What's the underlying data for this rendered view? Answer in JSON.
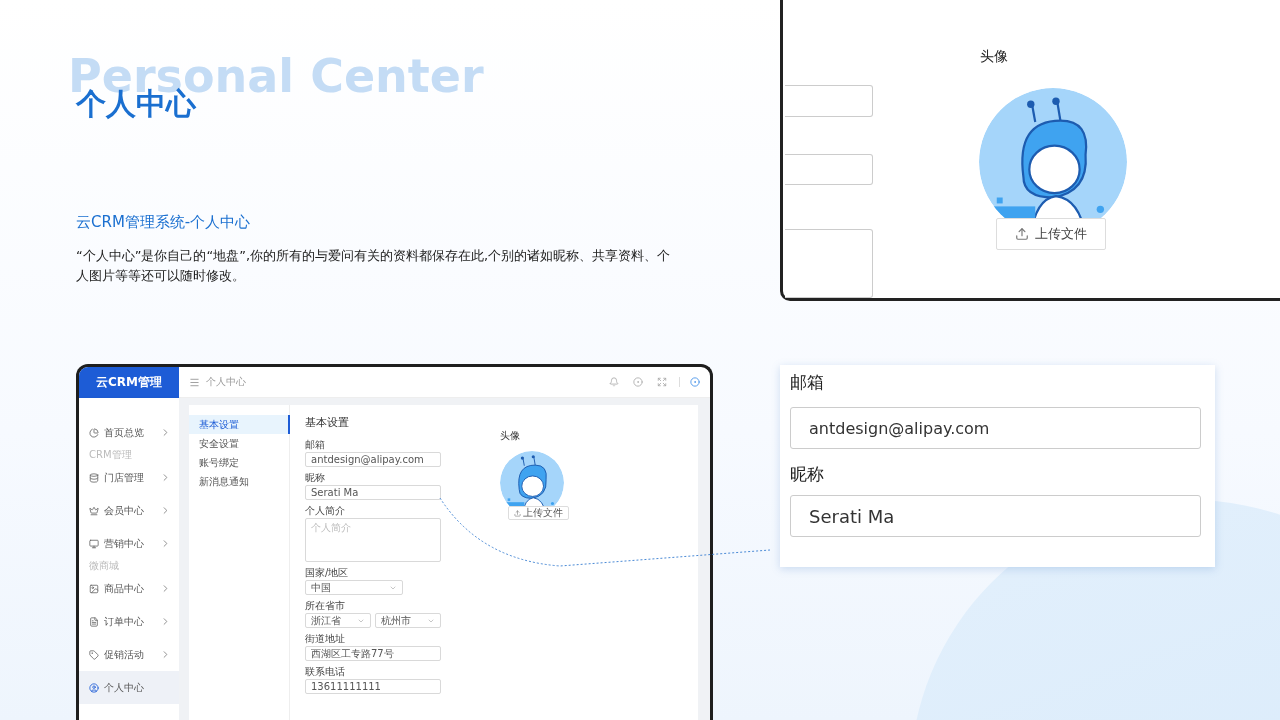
{
  "hero": {
    "ghost_title": "Personal Center",
    "title": "个人中心",
    "subtitle": "云CRM管理系统-个人中心",
    "description": "“个人中心”是你自己的“地盘”,你的所有的与爱问有关的资料都保存在此,个别的诸如昵称、共享资料、个人图片等等还可以随时修改。"
  },
  "mockup": {
    "logo": "云CRM管理",
    "breadcrumb": "个人中心",
    "sidebar": [
      {
        "kind": "item",
        "label": "首页总览",
        "selected": false,
        "has_children": true
      },
      {
        "kind": "section",
        "label": "CRM管理"
      },
      {
        "kind": "item",
        "label": "门店管理",
        "selected": false,
        "has_children": true
      },
      {
        "kind": "item",
        "label": "会员中心",
        "selected": false,
        "has_children": true
      },
      {
        "kind": "item",
        "label": "营销中心",
        "selected": false,
        "has_children": true
      },
      {
        "kind": "section",
        "label": "微商城"
      },
      {
        "kind": "item",
        "label": "商品中心",
        "selected": false,
        "has_children": true
      },
      {
        "kind": "item",
        "label": "订单中心",
        "selected": false,
        "has_children": true
      },
      {
        "kind": "item",
        "label": "促销活动",
        "selected": false,
        "has_children": true
      },
      {
        "kind": "item",
        "label": "个人中心",
        "selected": true,
        "has_children": false
      }
    ],
    "tabs": [
      {
        "label": "基本设置",
        "selected": true
      },
      {
        "label": "安全设置",
        "selected": false
      },
      {
        "label": "账号绑定",
        "selected": false
      },
      {
        "label": "新消息通知",
        "selected": false
      }
    ],
    "form": {
      "title": "基本设置",
      "fields": [
        {
          "kind": "input",
          "label": "邮箱",
          "value": "antdesign@alipay.com"
        },
        {
          "kind": "input",
          "label": "昵称",
          "value": "Serati Ma"
        },
        {
          "kind": "textarea",
          "label": "个人简介",
          "placeholder": "个人简介"
        },
        {
          "kind": "select",
          "label": "国家/地区",
          "values": [
            "中国"
          ]
        },
        {
          "kind": "select",
          "label": "所在省市",
          "values": [
            "浙江省",
            "杭州市"
          ]
        },
        {
          "kind": "input",
          "label": "街道地址",
          "value": "西湖区工专路77号"
        },
        {
          "kind": "input",
          "label": "联系电话",
          "value": "13611111111"
        }
      ]
    },
    "avatar": {
      "label": "头像",
      "button": "上传文件"
    }
  },
  "zoom_avatar": {
    "label": "头像",
    "button": "上传文件"
  },
  "detail": {
    "fields": [
      {
        "label": "邮箱",
        "value": "antdesign@alipay.com"
      },
      {
        "label": "昵称",
        "value": "Serati Ma"
      }
    ]
  }
}
